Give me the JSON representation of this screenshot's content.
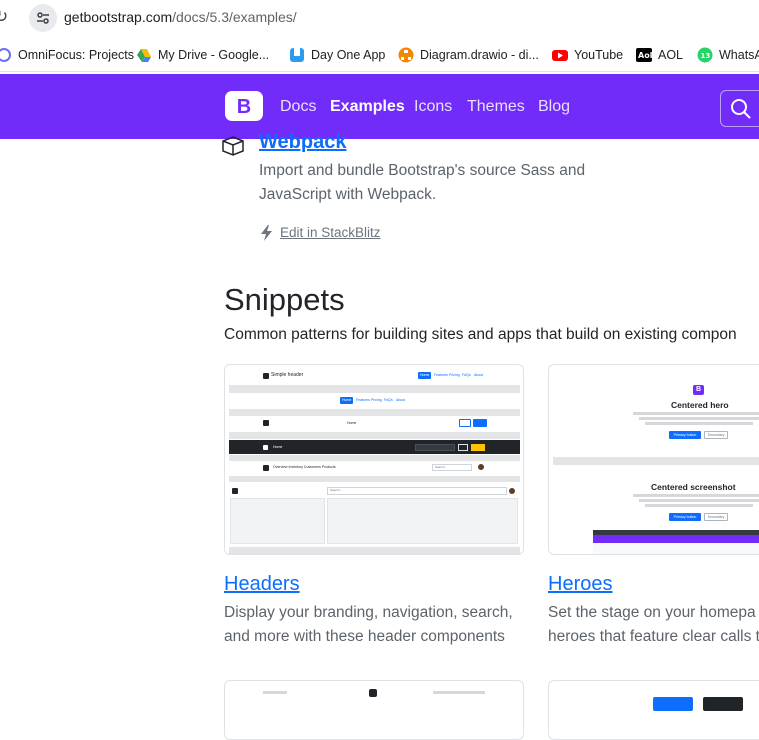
{
  "browser": {
    "url_host": "getbootstrap.com",
    "url_path": "/docs/5.3/examples/",
    "bookmarks": [
      {
        "label": "OmniFocus: Projects",
        "icon": "omnifocus-icon"
      },
      {
        "label": "My Drive - Google...",
        "icon": "google-drive-icon"
      },
      {
        "label": "Day One App",
        "icon": "day-one-icon"
      },
      {
        "label": "Diagram.drawio - di...",
        "icon": "drawio-icon"
      },
      {
        "label": "YouTube",
        "icon": "youtube-icon"
      },
      {
        "label": "AOL",
        "icon": "aol-icon"
      },
      {
        "label": "WhatsAp",
        "icon": "whatsapp-icon"
      }
    ]
  },
  "navbar": {
    "logo_letter": "B",
    "links": [
      "Docs",
      "Examples",
      "Icons",
      "Themes",
      "Blog"
    ],
    "active": "Examples",
    "brand_color": "#712cf9"
  },
  "webpack": {
    "title": "Webpack",
    "description_line1": "Import and bundle Bootstrap's source Sass and",
    "description_line2": "JavaScript with Webpack.",
    "edit_link": "Edit in StackBlitz"
  },
  "snippets": {
    "heading": "Snippets",
    "lead": "Common patterns for building sites and apps that build on existing compon",
    "cards": [
      {
        "title": "Headers",
        "desc_line1": "Display your branding, navigation, search,",
        "desc_line2": "and more with these header components",
        "thumb_brand": "Simple header",
        "thumb_tabs": [
          "Home",
          "Features",
          "Pricing",
          "FAQs",
          "About"
        ],
        "thumb_nav2": [
          "Home",
          "Features",
          "Pricing",
          "FAQs",
          "About"
        ],
        "thumb_nav3": "Overview  Inventory  Customers  Products",
        "thumb_search": "Search..."
      },
      {
        "title": "Heroes",
        "desc_line1": "Set the stage on your homepa",
        "desc_line2": "heroes that feature clear calls t",
        "hero1_title": "Centered hero",
        "hero2_title": "Centered screenshot",
        "primary_btn": "Primary button",
        "secondary_btn": "Secondary"
      }
    ]
  }
}
